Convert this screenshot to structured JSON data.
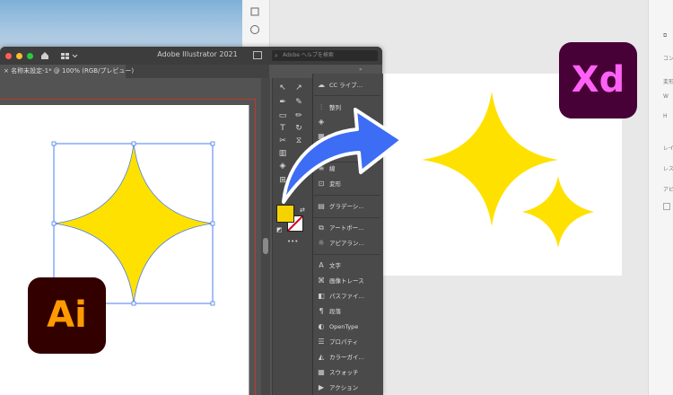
{
  "illustrator": {
    "window_title": "Adobe Illustrator 2021",
    "tab_label": "× 名称未設定-1* @ 100% (RGB/プレビュー)",
    "search_placeholder": "Adobe ヘルプを検索",
    "logo_text": "Ai",
    "panels": [
      {
        "label": "CC ライブ…",
        "icon": "cc-libraries-icon"
      },
      {
        "label": "整列",
        "icon": "align-icon"
      },
      {
        "label": "",
        "icon": "layers-icon"
      },
      {
        "label": "",
        "icon": "swatch-grid-icon"
      },
      {
        "label": "線",
        "icon": "stroke-icon"
      },
      {
        "label": "変形",
        "icon": "transform-icon"
      },
      {
        "label": "グラデーシ…",
        "icon": "gradient-icon"
      },
      {
        "label": "アートボー…",
        "icon": "artboards-icon"
      },
      {
        "label": "アピアラン…",
        "icon": "appearance-icon"
      },
      {
        "label": "文字",
        "icon": "character-icon"
      },
      {
        "label": "画像トレース",
        "icon": "image-trace-icon"
      },
      {
        "label": "パスファイ…",
        "icon": "pathfinder-icon"
      },
      {
        "label": "段落",
        "icon": "paragraph-icon"
      },
      {
        "label": "OpenType",
        "icon": "opentype-icon"
      },
      {
        "label": "プロパティ",
        "icon": "properties-icon"
      },
      {
        "label": "カラーガイ…",
        "icon": "color-guide-icon"
      },
      {
        "label": "スウォッチ",
        "icon": "swatches-icon"
      },
      {
        "label": "アクション",
        "icon": "actions-icon"
      }
    ],
    "fill_color": "#f5d300",
    "more_tools": "•••"
  },
  "xd": {
    "logo_text": "Xd",
    "right_panel_labels": [
      "コン",
      "変形",
      "W",
      "H",
      "レイ",
      "レス",
      "アピ"
    ]
  },
  "colors": {
    "sparkle": "#ffe100",
    "arrow": "#3d6cf5",
    "ai_logo_bg": "#330000",
    "ai_logo_fg": "#ff9a00",
    "xd_logo_bg": "#470137",
    "xd_logo_fg": "#ff61f6"
  }
}
